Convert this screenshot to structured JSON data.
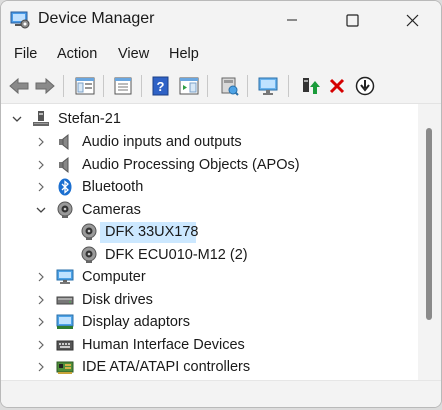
{
  "window": {
    "title": "Device Manager"
  },
  "menu": [
    "File",
    "Action",
    "View",
    "Help"
  ],
  "toolbar": {
    "buttons": [
      "back",
      "forward",
      "show-hide-console-tree",
      "properties",
      "help",
      "show-action-pane",
      "scan-hardware",
      "monitor",
      "update-driver",
      "uninstall-device",
      "disable-device"
    ]
  },
  "tree": {
    "root": "Stefan-21",
    "items": [
      "Audio inputs and outputs",
      "Audio Processing Objects (APOs)",
      "Bluetooth",
      "Cameras",
      "DFK 33UX178",
      "DFK ECU010-M12 (2)",
      "Computer",
      "Disk drives",
      "Display adaptors",
      "Human Interface Devices",
      "IDE ATA/ATAPI controllers"
    ],
    "selected": "DFK 33UX178"
  },
  "colors": {
    "selection": "#cce8ff",
    "chrome": "#f3f3f3",
    "delete_red": "#d50000",
    "update_green": "#1a9b3a"
  }
}
